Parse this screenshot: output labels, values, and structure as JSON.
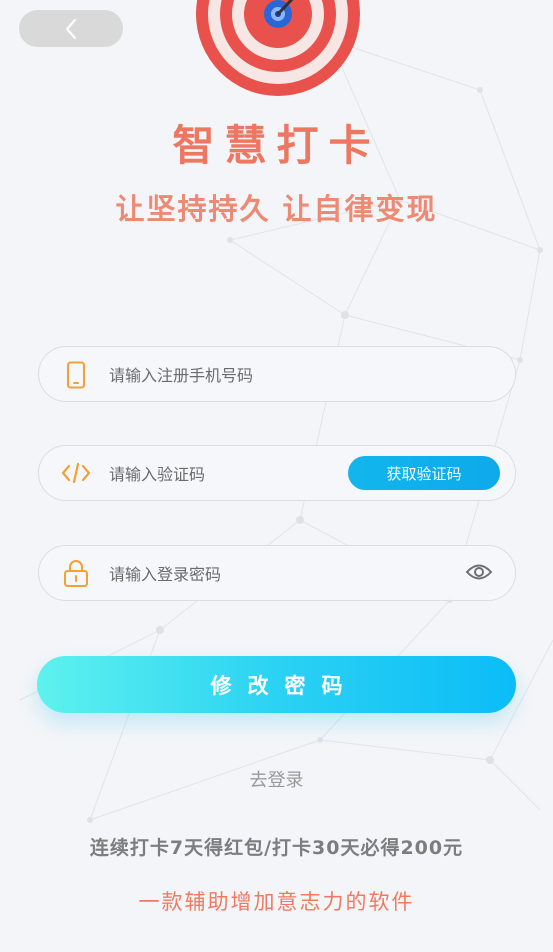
{
  "header": {
    "back_icon": "chevron-left-icon",
    "logo_icon": "target-dart-icon",
    "title": "智慧打卡",
    "slogan": "让坚持持久 让自律变现"
  },
  "form": {
    "phone": {
      "icon": "phone-icon",
      "placeholder": "请输入注册手机号码",
      "value": ""
    },
    "code": {
      "icon": "code-icon",
      "placeholder": "请输入验证码",
      "value": "",
      "button_label": "获取验证码"
    },
    "password": {
      "icon": "lock-icon",
      "placeholder": "请输入登录密码",
      "value": "",
      "toggle_icon": "eye-icon"
    },
    "submit_label": "修改密码",
    "login_link": "去登录"
  },
  "footer": {
    "promo": "连续打卡7天得红包/打卡30天必得200元",
    "tagline": "一款辅助增加意志力的软件"
  },
  "colors": {
    "accent_red": "#ec7862",
    "accent_orange": "#f2a13a",
    "button_blue": "#12b6ec",
    "gradient_start": "#5ef2ee",
    "gradient_end": "#0bbcf7"
  }
}
